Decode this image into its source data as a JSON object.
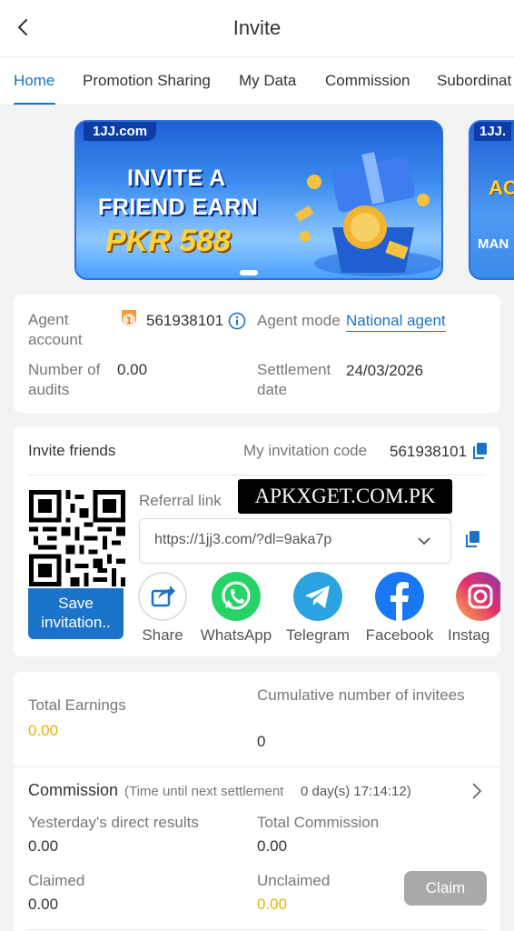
{
  "header": {
    "title": "Invite"
  },
  "tabs": [
    {
      "label": "Home"
    },
    {
      "label": "Promotion Sharing"
    },
    {
      "label": "My Data"
    },
    {
      "label": "Commission"
    },
    {
      "label": "Subordinat"
    }
  ],
  "banners": [
    {
      "brand": "1JJ.com",
      "line1": "INVITE A",
      "line2": "FRIEND EARN",
      "amount": "PKR 588"
    },
    {
      "brand": "1JJ.",
      "line1": "AC",
      "line2": "MAN"
    }
  ],
  "agent_info": {
    "agent_account_label": "Agent account",
    "agent_account_value": "561938101",
    "agent_mode_label": "Agent mode",
    "agent_mode_value": "National agent",
    "audits_label": "Number of audits",
    "audits_value": "0.00",
    "settlement_label": "Settlement date",
    "settlement_value": "24/03/2026"
  },
  "invite": {
    "title": "Invite friends",
    "code_label": "My invitation code",
    "code_value": "561938101",
    "referral_label": "Referral link",
    "referral_link": "https://1jj3.com/?dl=9aka7p",
    "save_label": "Save invitation..",
    "share_items": [
      {
        "label": "Share",
        "icon": "share-icon"
      },
      {
        "label": "WhatsApp",
        "icon": "whatsapp-icon"
      },
      {
        "label": "Telegram",
        "icon": "telegram-icon"
      },
      {
        "label": "Facebook",
        "icon": "facebook-icon"
      },
      {
        "label": "Instag",
        "icon": "instagram-icon"
      }
    ]
  },
  "watermark": "APKXGET.COM.PK",
  "earnings": {
    "total_label": "Total Earnings",
    "total_value": "0.00",
    "cumulative_label": "Cumulative number of invitees",
    "cumulative_value": "0"
  },
  "commission": {
    "title": "Commission",
    "countdown_prefix": "(Time until next settlement",
    "countdown_value": "0 day(s) 17:14:12)",
    "yesterday_label": "Yesterday's direct results",
    "yesterday_value": "0.00",
    "total_label": "Total Commission",
    "total_value": "0.00",
    "claimed_label": "Claimed",
    "claimed_value": "0.00",
    "unclaimed_label": "Unclaimed",
    "unclaimed_value": "0.00",
    "claim_button": "Claim"
  },
  "colors": {
    "accent": "#1a73c8",
    "highlight": "#e8b400",
    "disabled": "#a9a9a9"
  }
}
